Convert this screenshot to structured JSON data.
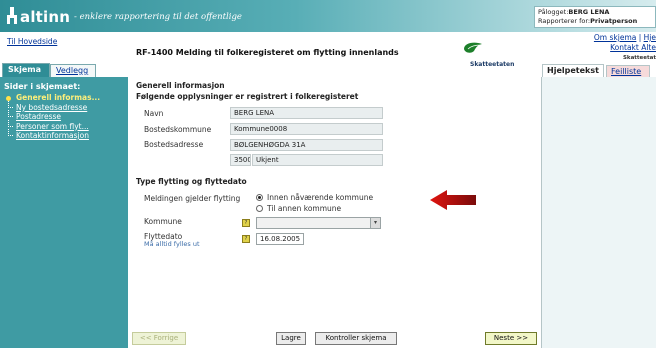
{
  "banner": {
    "logo": "altinn",
    "tagline": "- enklere rapportering til det offentlige",
    "logged_in_label": "Pålogget:",
    "logged_in_name": "BERG LENA",
    "reporting_for_label": "Rapporterer for:",
    "reporting_for_value": "Privatperson"
  },
  "header": {
    "home_link": "Til Hovedside",
    "form_title": "RF-1400 Melding til folkeregisteret om flytting innenlands",
    "agency_name": "Skatteetaten",
    "link_about": "Om skjema",
    "link_help_partial": "Hje",
    "link_contact": "Kontakt Alte",
    "agency_small": "Skatteetat"
  },
  "left_tabs": {
    "active": "Skjema",
    "other": "Vedlegg"
  },
  "sidebar": {
    "title": "Sider i skjemaet:",
    "items": [
      {
        "label": "Generell informas..."
      },
      {
        "label": "Ny bostedsadresse"
      },
      {
        "label": "Postadresse"
      },
      {
        "label": "Personer som flyt..."
      },
      {
        "label": "Kontaktinformasjon"
      }
    ]
  },
  "general": {
    "title": "Generell informasjon",
    "subtitle": "Følgende opplysninger er registrert i folkeregisteret",
    "name_label": "Navn",
    "name_value": "BERG LENA",
    "municipality_label": "Bostedskommune",
    "municipality_value": "Kommune0008",
    "address_label": "Bostedsadresse",
    "address_value": "BØLGENHØGDA 31A",
    "postcode": "3500",
    "postplace": "Ukjent"
  },
  "moving": {
    "title": "Type flytting og flyttedato",
    "applies_label": "Meldingen gjelder flytting",
    "option_within": "Innen nåværende kommune",
    "option_other": "Til annen kommune",
    "municipality_label": "Kommune",
    "municipality_value": "",
    "date_label": "Flyttedato",
    "date_note": "Må alltid fylles ut",
    "date_value": "16.08.2005"
  },
  "right_tabs": {
    "active": "Hjelpetekst",
    "other": "Feilliste"
  },
  "buttons": {
    "prev": "<< Forrige",
    "save": "Lagre",
    "check": "Kontroller skjema",
    "next": "Neste >>"
  },
  "colors": {
    "banner": "#2f8d96",
    "sidebar": "#3f9ba3",
    "arrow": "#c8090b",
    "link": "#003399"
  }
}
